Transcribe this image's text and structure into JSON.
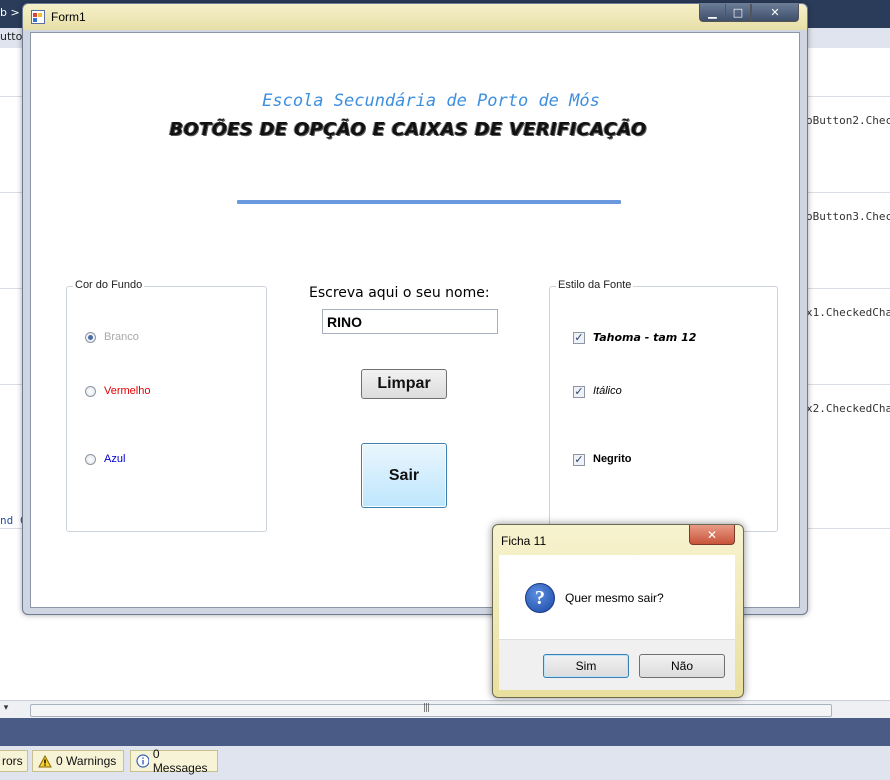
{
  "ide": {
    "tab_partial": "b  >",
    "toolbar_partial": "utto",
    "code_lines": [
      "oButton2.Check",
      "oButton3.Check",
      "x1.CheckedCha",
      "x2.CheckedCha"
    ],
    "left_partial": "nd  C",
    "status": {
      "errors_label": "rors",
      "warnings_label": "0 Warnings",
      "messages_label": "0 Messages"
    },
    "scroll_grip": "|||"
  },
  "form1": {
    "title": "Form1",
    "window_buttons": {
      "minimize": "▁",
      "maximize": "□",
      "close": "✕"
    },
    "school_title": "Escola Secundária de Porto de Mós",
    "subtitle": "BOTÕES DE OPÇÃO E CAIXAS DE VERIFICAÇÃO",
    "background_group": {
      "label": "Cor do Fundo",
      "options": [
        {
          "label": "Branco",
          "checked": true,
          "color": "#a9a9a9"
        },
        {
          "label": "Vermelho",
          "checked": false,
          "color": "#e00000"
        },
        {
          "label": "Azul",
          "checked": false,
          "color": "#0000cc"
        }
      ]
    },
    "name_prompt": "Escreva aqui o seu nome:",
    "name_value": "RINO",
    "clear_button": "Limpar",
    "exit_button": "Sair",
    "font_group": {
      "label": "Estilo da Fonte",
      "options": [
        {
          "label": "Tahoma - tam 12",
          "checked": true
        },
        {
          "label": "Itálico",
          "checked": true
        },
        {
          "label": "Negrito",
          "checked": true
        }
      ]
    }
  },
  "dialog": {
    "title": "Ficha 11",
    "close": "✕",
    "message": "Quer mesmo sair?",
    "yes_button": "Sim",
    "no_button": "Não",
    "icon": "question-icon"
  },
  "colors": {
    "title_blue": "#3e8fe0",
    "divider_blue": "#6a99e0"
  }
}
